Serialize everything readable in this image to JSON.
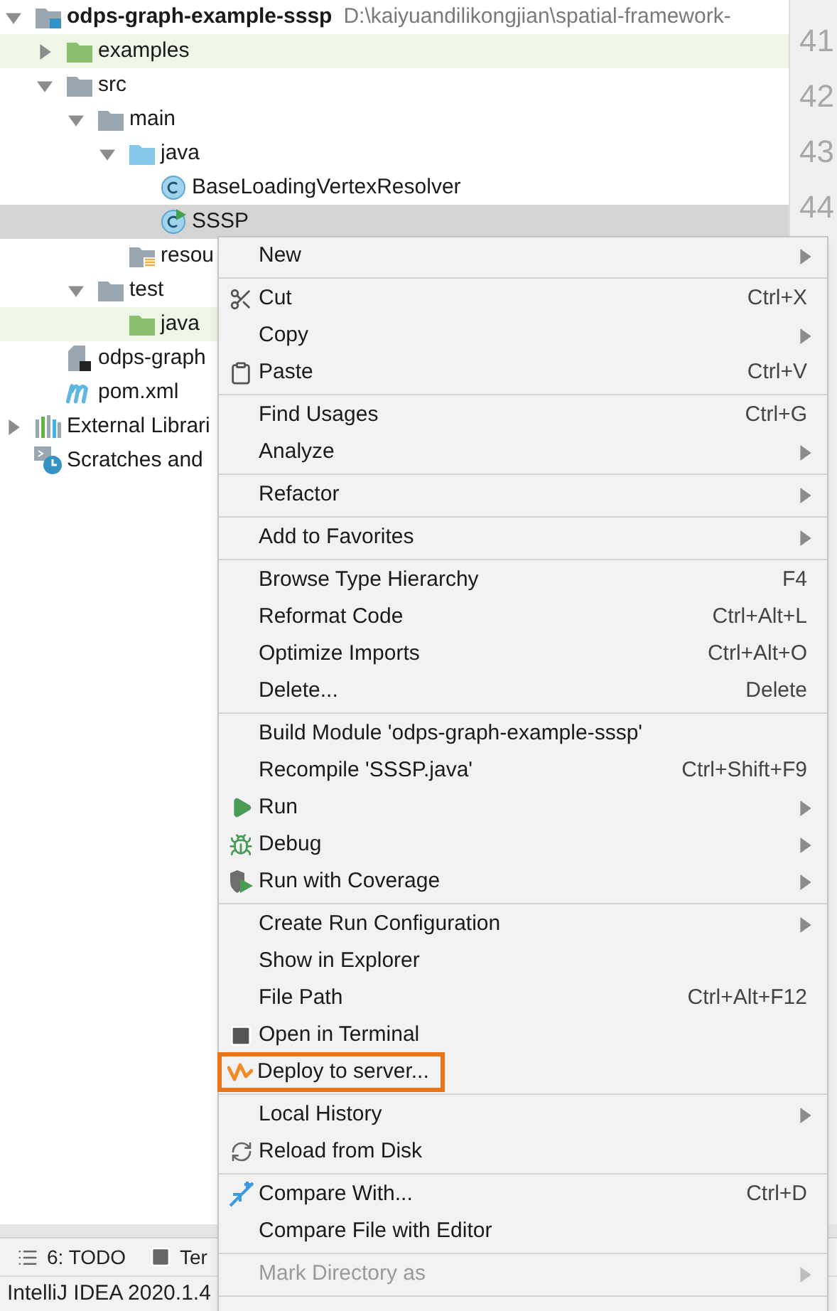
{
  "project_tree": {
    "root": {
      "label": "odps-graph-example-sssp",
      "path": "D:\\kaiyuandilikongjian\\spatial-framework-",
      "kind": "module",
      "expanded": true,
      "selected": false,
      "highlighted": false,
      "children": [
        {
          "label": "examples",
          "kind": "test_folder",
          "expanded": false,
          "selected": false,
          "highlighted": true
        },
        {
          "label": "src",
          "kind": "folder",
          "expanded": true,
          "selected": false,
          "highlighted": false,
          "children": [
            {
              "label": "main",
              "kind": "folder",
              "expanded": true,
              "selected": false,
              "highlighted": false,
              "children": [
                {
                  "label": "java",
                  "kind": "source_folder",
                  "expanded": true,
                  "selected": false,
                  "highlighted": false,
                  "children": [
                    {
                      "label": "BaseLoadingVertexResolver",
                      "kind": "class",
                      "selected": false,
                      "highlighted": false
                    },
                    {
                      "label": "SSSP",
                      "kind": "runnable_class",
                      "selected": true
                    }
                  ]
                },
                {
                  "label": "resou",
                  "kind": "resources_folder",
                  "selected": false,
                  "highlighted": false
                }
              ]
            },
            {
              "label": "test",
              "kind": "folder",
              "expanded": true,
              "selected": false,
              "highlighted": false,
              "children": [
                {
                  "label": "java",
                  "kind": "test_folder",
                  "selected": false,
                  "highlighted": true
                }
              ]
            }
          ]
        },
        {
          "label": "odps-graph",
          "kind": "file",
          "selected": false,
          "highlighted": false
        },
        {
          "label": "pom.xml",
          "kind": "maven",
          "selected": false,
          "highlighted": false
        }
      ]
    },
    "extra": [
      {
        "label": "External Librari",
        "kind": "libraries",
        "expanded": false,
        "selected": false,
        "highlighted": false
      },
      {
        "label": "Scratches and",
        "kind": "scratches",
        "selected": false,
        "highlighted": false
      }
    ]
  },
  "gutter": {
    "line_numbers": [
      "41",
      "42",
      "43",
      "44"
    ]
  },
  "tool_window_bar": [
    {
      "label": "6: TODO",
      "kind": "list"
    },
    {
      "label": "Ter",
      "kind": "terminal"
    }
  ],
  "status_bar": {
    "text": "IntelliJ IDEA 2020.1.4"
  },
  "context_menu": {
    "groups": [
      [
        {
          "label": "New",
          "submenu": true,
          "disabled": false,
          "highlighted": false
        }
      ],
      [
        {
          "label": "Cut",
          "shortcut": "Ctrl+X",
          "kind": "cut",
          "submenu": false,
          "disabled": false,
          "highlighted": false
        },
        {
          "label": "Copy",
          "submenu": true,
          "disabled": false,
          "highlighted": false
        },
        {
          "label": "Paste",
          "shortcut": "Ctrl+V",
          "kind": "paste",
          "submenu": false,
          "disabled": false,
          "highlighted": false
        }
      ],
      [
        {
          "label": "Find Usages",
          "shortcut": "Ctrl+G",
          "submenu": false,
          "disabled": false,
          "highlighted": false
        },
        {
          "label": "Analyze",
          "submenu": true,
          "disabled": false,
          "highlighted": false
        }
      ],
      [
        {
          "label": "Refactor",
          "submenu": true,
          "disabled": false,
          "highlighted": false
        }
      ],
      [
        {
          "label": "Add to Favorites",
          "submenu": true,
          "disabled": false,
          "highlighted": false
        }
      ],
      [
        {
          "label": "Browse Type Hierarchy",
          "shortcut": "F4",
          "submenu": false,
          "disabled": false,
          "highlighted": false
        },
        {
          "label": "Reformat Code",
          "shortcut": "Ctrl+Alt+L",
          "submenu": false,
          "disabled": false,
          "highlighted": false
        },
        {
          "label": "Optimize Imports",
          "shortcut": "Ctrl+Alt+O",
          "submenu": false,
          "disabled": false,
          "highlighted": false
        },
        {
          "label": "Delete...",
          "shortcut": "Delete",
          "submenu": false,
          "disabled": false,
          "highlighted": false
        }
      ],
      [
        {
          "label": "Build Module 'odps-graph-example-sssp'",
          "submenu": false,
          "disabled": false,
          "highlighted": false
        },
        {
          "label": "Recompile 'SSSP.java'",
          "shortcut": "Ctrl+Shift+F9",
          "submenu": false,
          "disabled": false,
          "highlighted": false
        },
        {
          "label": "Run",
          "kind": "run",
          "submenu": true,
          "disabled": false,
          "highlighted": false
        },
        {
          "label": "Debug",
          "kind": "debug",
          "submenu": true,
          "disabled": false,
          "highlighted": false
        },
        {
          "label": "Run with Coverage",
          "kind": "coverage",
          "submenu": true,
          "disabled": false,
          "highlighted": false
        }
      ],
      [
        {
          "label": "Create Run Configuration",
          "submenu": true,
          "disabled": false,
          "highlighted": false
        },
        {
          "label": "Show in Explorer",
          "submenu": false,
          "disabled": false,
          "highlighted": false
        },
        {
          "label": "File Path",
          "shortcut": "Ctrl+Alt+F12",
          "submenu": false,
          "disabled": false,
          "highlighted": false
        },
        {
          "label": "Open in Terminal",
          "kind": "terminal",
          "submenu": false,
          "disabled": false,
          "highlighted": false
        },
        {
          "label": "Deploy to server...",
          "kind": "deploy",
          "submenu": false,
          "disabled": false,
          "highlighted": true
        }
      ],
      [
        {
          "label": "Local History",
          "submenu": true,
          "disabled": false,
          "highlighted": false
        },
        {
          "label": "Reload from Disk",
          "kind": "reload",
          "submenu": false,
          "disabled": false,
          "highlighted": false
        }
      ],
      [
        {
          "label": "Compare With...",
          "shortcut": "Ctrl+D",
          "kind": "compare",
          "submenu": false,
          "disabled": false,
          "highlighted": false
        },
        {
          "label": "Compare File with Editor",
          "submenu": false,
          "disabled": false,
          "highlighted": false
        }
      ],
      [
        {
          "label": "Mark Directory as",
          "submenu": true,
          "disabled": true,
          "highlighted": false
        }
      ]
    ]
  }
}
